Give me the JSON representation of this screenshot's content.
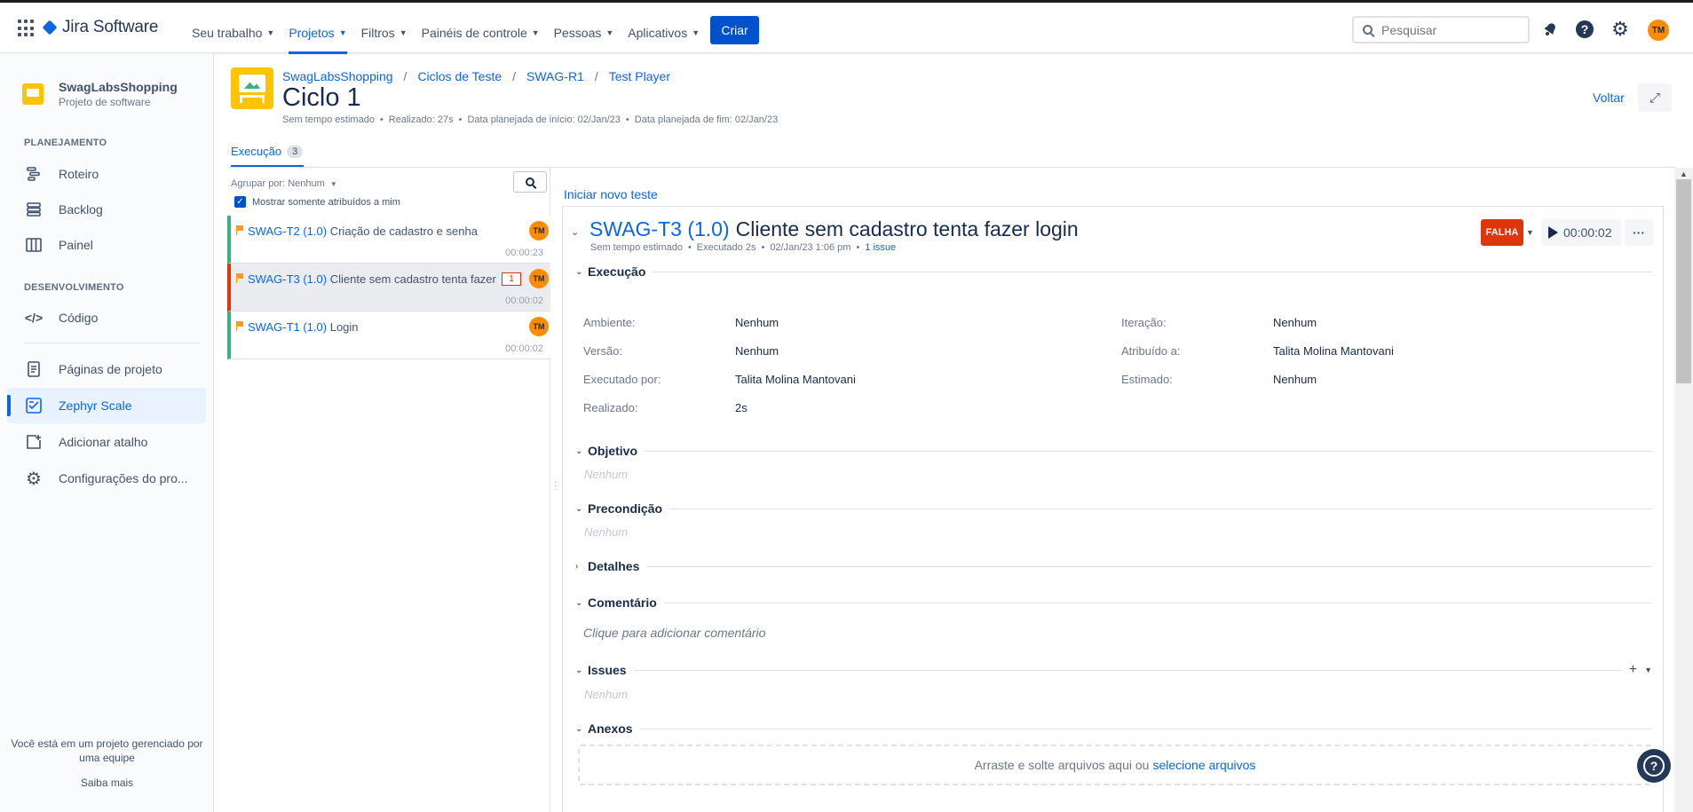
{
  "topbar": {
    "logo_text": "Jira Software",
    "nav": [
      {
        "label": "Seu trabalho"
      },
      {
        "label": "Projetos"
      },
      {
        "label": "Filtros"
      },
      {
        "label": "Painéis de controle"
      },
      {
        "label": "Pessoas"
      },
      {
        "label": "Aplicativos"
      }
    ],
    "create_label": "Criar",
    "search_placeholder": "Pesquisar",
    "avatar_initials": "TM",
    "accent": "#0c66e4"
  },
  "sidebar": {
    "project_name": "SwagLabsShopping",
    "project_type": "Projeto de software",
    "section_planning": "PLANEJAMENTO",
    "section_dev": "DESENVOLVIMENTO",
    "items": [
      {
        "label": "Roteiro",
        "icon": "roadmap-icon"
      },
      {
        "label": "Backlog",
        "icon": "backlog-icon"
      },
      {
        "label": "Painel",
        "icon": "board-icon"
      },
      {
        "label": "Código",
        "icon": "code-icon"
      },
      {
        "label": "Páginas de projeto",
        "icon": "pages-icon"
      },
      {
        "label": "Zephyr Scale",
        "icon": "zephyr-icon"
      },
      {
        "label": "Adicionar atalho",
        "icon": "add-shortcut-icon"
      },
      {
        "label": "Configurações do pro...",
        "icon": "settings-icon"
      }
    ],
    "footer_text": "Você está em um projeto gerenciado por uma equipe",
    "footer_link": "Saiba mais"
  },
  "header": {
    "breadcrumbs": [
      "SwagLabsShopping",
      "Ciclos de Teste",
      "SWAG-R1",
      "Test Player"
    ],
    "title": "Ciclo 1",
    "meta": [
      "Sem tempo estimado",
      "Realizado: 27s",
      "Data planejada de início: 02/Jan/23",
      "Data planejada de fim: 02/Jan/23"
    ],
    "back_label": "Voltar"
  },
  "tabs": [
    {
      "label": "Execução",
      "count": "3"
    }
  ],
  "list": {
    "group_by": "Agrupar por: Nenhum",
    "only_assigned": "Mostrar somente atribuídos a mim",
    "rows": [
      {
        "key": "SWAG-T2 (1.0)",
        "name": "Criação de cadastro e senha",
        "time": "00:00:23",
        "status": "pass",
        "avatar": "TM"
      },
      {
        "key": "SWAG-T3 (1.0)",
        "name": "Cliente sem cadastro tenta fazer login",
        "time": "00:00:02",
        "status": "fail",
        "badge": "1",
        "avatar": "TM"
      },
      {
        "key": "SWAG-T1 (1.0)",
        "name": "Login",
        "time": "00:00:02",
        "status": "pass",
        "avatar": "TM"
      }
    ]
  },
  "detail": {
    "new_test": "Iniciar novo teste",
    "key": "SWAG-T3 (1.0)",
    "title": "Cliente sem cadastro tenta fazer login",
    "meta": [
      "Sem tempo estimado",
      "Executado 2s",
      "02/Jan/23 1:06 pm"
    ],
    "issue_link": "1 issue",
    "status": "FALHA",
    "timer": "00:00:02",
    "more": "···",
    "sections": {
      "execution": "Execução",
      "objective": "Objetivo",
      "precondition": "Precondição",
      "details": "Detalhes",
      "comment": "Comentário",
      "issues": "Issues",
      "attachments": "Anexos"
    },
    "fields": [
      {
        "label": "Ambiente:",
        "value": "Nenhum"
      },
      {
        "label": "Iteração:",
        "value": "Nenhum"
      },
      {
        "label": "Versão:",
        "value": "Nenhum"
      },
      {
        "label": "Atribuído a:",
        "value": "Talita Molina Mantovani"
      },
      {
        "label": "Executado por:",
        "value": "Talita Molina Mantovani"
      },
      {
        "label": "Estimado:",
        "value": "Nenhum"
      },
      {
        "label": "Realizado:",
        "value": "2s"
      }
    ],
    "none_placeholder": "Nenhum",
    "comment_placeholder": "Clique para adicionar comentário",
    "dropzone_text": "Arraste e solte arquivos aqui ou",
    "dropzone_link": "selecione arquivos",
    "status_color": "#de350b"
  }
}
